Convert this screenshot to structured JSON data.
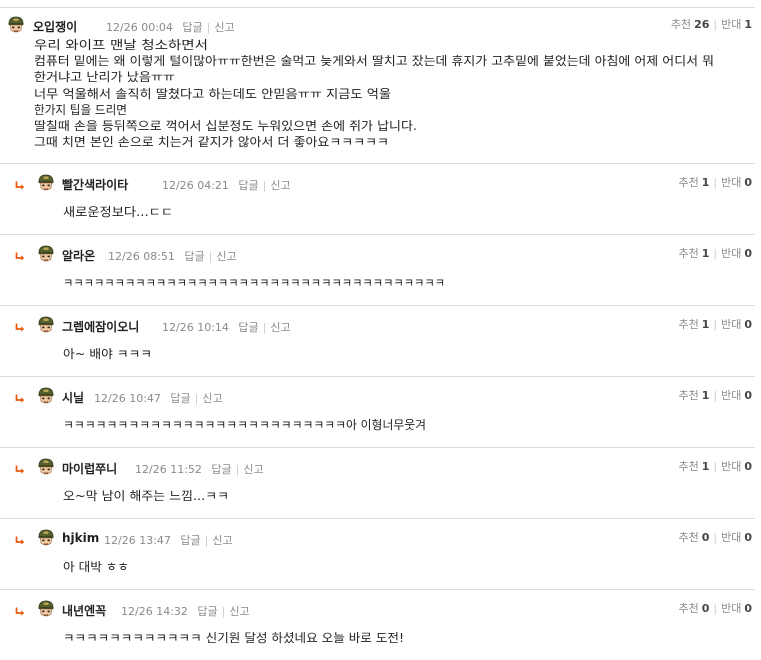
{
  "labels": {
    "reply": "답글",
    "report": "신고",
    "up": "추천",
    "down": "반대"
  },
  "comments": [
    {
      "nick": "오입쟁이",
      "date": "12/26 00:04",
      "up": "26",
      "down": "1",
      "reply": false,
      "lines": [
        "우리 와이프 맨날 청소하면서",
        "컴퓨터 밑에는 왜 이렇게 털이많아ㅠㅠ한번은 술먹고 늦게와서 딸치고 잤는데 휴지가 고추밑에 붙었는데 아침에 어제 어디서 뭐",
        "한거냐고 난리가 났음ㅠㅠ",
        "너무 억울해서 솔직히 딸쳤다고 하는데도 안믿음ㅠㅠ 지금도 억울",
        "한가지 팁을 드리면",
        "딸칠때 손을 등뒤쪽으로 꺽어서 십분정도 누워있으면 손에 쥐가 납니다.",
        "그때 치면 본인 손으로 치는거 같지가 않아서 더 좋아요ㅋㅋㅋㅋㅋ"
      ]
    },
    {
      "nick": "빨간색라이타",
      "date": "12/26 04:21",
      "up": "1",
      "down": "0",
      "reply": true,
      "lines": [
        "새로운정보다...ㄷㄷ"
      ]
    },
    {
      "nick": "알라온",
      "date": "12/26 08:51",
      "up": "1",
      "down": "0",
      "reply": true,
      "lines": [
        "ㅋㅋㅋㅋㅋㅋㅋㅋㅋㅋㅋㅋㅋㅋㅋㅋㅋㅋㅋㅋㅋㅋㅋㅋㅋㅋㅋㅋㅋㅋㅋㅋㅋㅋㅋㅋㅋ"
      ]
    },
    {
      "nick": "그렙에잠이오니",
      "date": "12/26 10:14",
      "up": "1",
      "down": "0",
      "reply": true,
      "lines": [
        "아~ 배야 ㅋㅋㅋ"
      ]
    },
    {
      "nick": "시닐",
      "date": "12/26 10:47",
      "up": "1",
      "down": "0",
      "reply": true,
      "lines": [
        "ㅋㅋㅋㅋㅋㅋㅋㅋㅋㅋㅋㅋㅋㅋㅋㅋㅋㅋㅋㅋㅋㅋㅋㅋㅋㅋ아 이형너무웃겨"
      ]
    },
    {
      "nick": "마이럽쭈니",
      "date": "12/26 11:52",
      "up": "1",
      "down": "0",
      "reply": true,
      "lines": [
        "오~막 남이 해주는 느낌...ㅋㅋ"
      ]
    },
    {
      "nick": "hjkim",
      "date": "12/26 13:47",
      "up": "0",
      "down": "0",
      "reply": true,
      "lines": [
        "아 대박 ㅎㅎ"
      ]
    },
    {
      "nick": "내년엔꼭",
      "date": "12/26 14:32",
      "up": "0",
      "down": "0",
      "reply": true,
      "lines": [
        "ㅋㅋㅋㅋㅋㅋㅋㅋㅋㅋㅋㅋ 신기원 달성 하셨네요 오늘 바로 도전!"
      ]
    }
  ],
  "colors": {
    "text": "#222222",
    "meta": "#8a8a8a",
    "divider": "#dcdcdc",
    "reply_arrow": "#e8590c"
  },
  "icons": {
    "avatar": "soldier-avatar-icon",
    "reply": "reply-arrow-icon"
  }
}
